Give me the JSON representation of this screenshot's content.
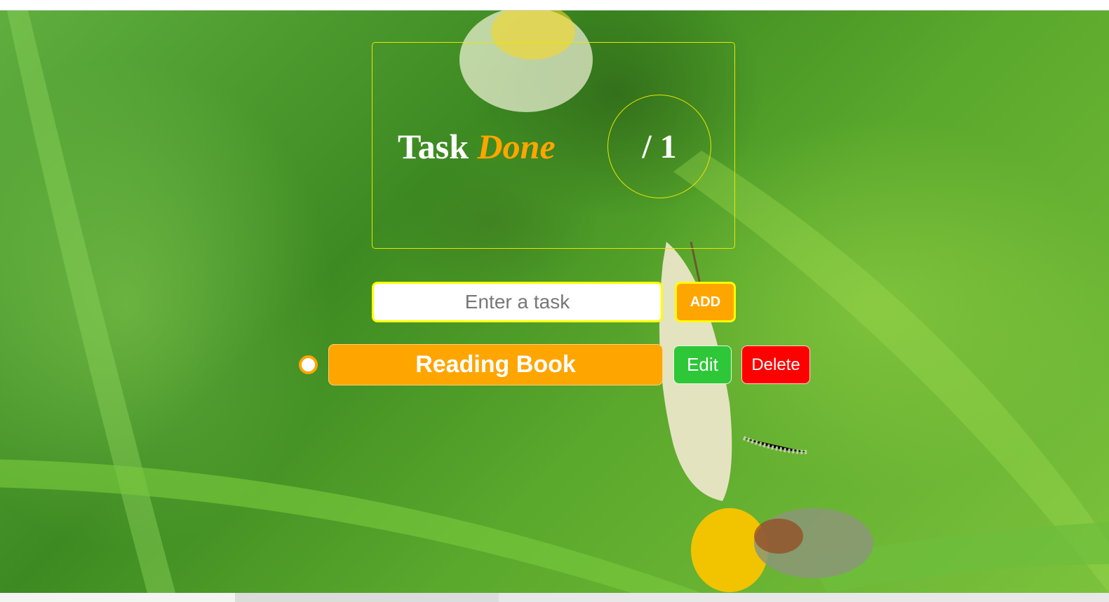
{
  "summary": {
    "title_word": "Task",
    "title_highlight": "Done",
    "counter": "/ 1"
  },
  "new_task": {
    "placeholder": "Enter a task",
    "value": "",
    "add_label": "ADD"
  },
  "tasks": [
    {
      "label": "Reading Book",
      "done": false,
      "edit_label": "Edit",
      "delete_label": "Delete"
    }
  ],
  "colors": {
    "accent": "#ffa500",
    "border_highlight": "#ffff00",
    "edit": "#2dc737",
    "delete": "#ff0000"
  }
}
